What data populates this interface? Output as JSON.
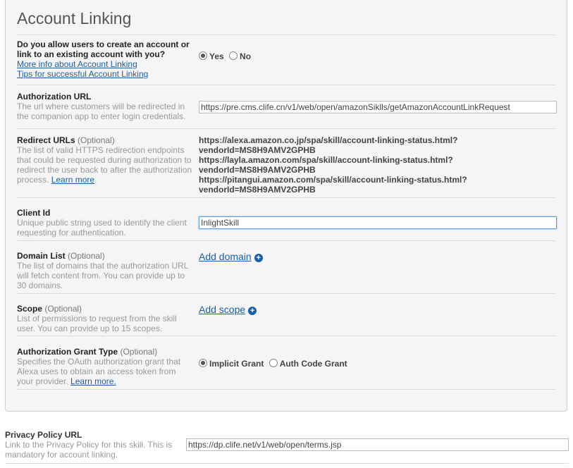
{
  "section_title": "Account Linking",
  "allow": {
    "question": "Do you allow users to create an account or link to an existing account with you?",
    "link1": "More info about Account Linking",
    "link2": "Tips for successful Account Linking",
    "options": [
      "Yes",
      "No"
    ],
    "selected": "Yes"
  },
  "auth_url": {
    "label": "Authorization URL",
    "desc": "The url where customers will be redirected in the companion app to enter login credentials.",
    "value": "https://pre.cms.clife.cn/v1/web/open/amazonSiklls/getAmazonAccountLinkRequest"
  },
  "redirect": {
    "label": "Redirect URLs",
    "optional": "(Optional)",
    "desc": "The list of valid HTTPS redirection endpoints that could be requested during authorization to redirect the user back to after the authorization process.",
    "learn": "Learn more",
    "urls": [
      "https://alexa.amazon.co.jp/spa/skill/account-linking-status.html?",
      "vendorId=MS8H9AMV2GPHB",
      "https://layla.amazon.com/spa/skill/account-linking-status.html?",
      "vendorId=MS8H9AMV2GPHB",
      "https://pitangui.amazon.com/spa/skill/account-linking-status.html?",
      "vendorId=MS8H9AMV2GPHB"
    ]
  },
  "client_id": {
    "label": "Client Id",
    "desc": "Unique public string used to identify the client requesting for authentication.",
    "value": "InlightSkill"
  },
  "domain": {
    "label": "Domain List",
    "optional": "(Optional)",
    "desc": "The list of domains that the authorization URL will fetch content from. You can provide up to 30 domains.",
    "add": "Add domain"
  },
  "scope": {
    "label": "Scope",
    "optional": "(Optional)",
    "desc": "List of permissions to request from the skill user. You can provide up to 15 scopes.",
    "add": "Add scope"
  },
  "grant": {
    "label": "Authorization Grant Type",
    "optional": "(Optional)",
    "desc": "Specifies the OAuth authorization grant that Alexa uses to obtain an access token from your provider.",
    "learn": "Learn more.",
    "options": [
      "Implicit Grant",
      "Auth Code Grant"
    ],
    "selected": "Implicit Grant"
  },
  "privacy": {
    "label": "Privacy Policy URL",
    "desc": "Link to the Privacy Policy for this skill. This is mandatory for account linking.",
    "value": "https://dp.clife.net/v1/web/open/terms.jsp"
  },
  "colors": {
    "link": "#1a5ea8",
    "panel_bg": "#f5f5f5"
  }
}
